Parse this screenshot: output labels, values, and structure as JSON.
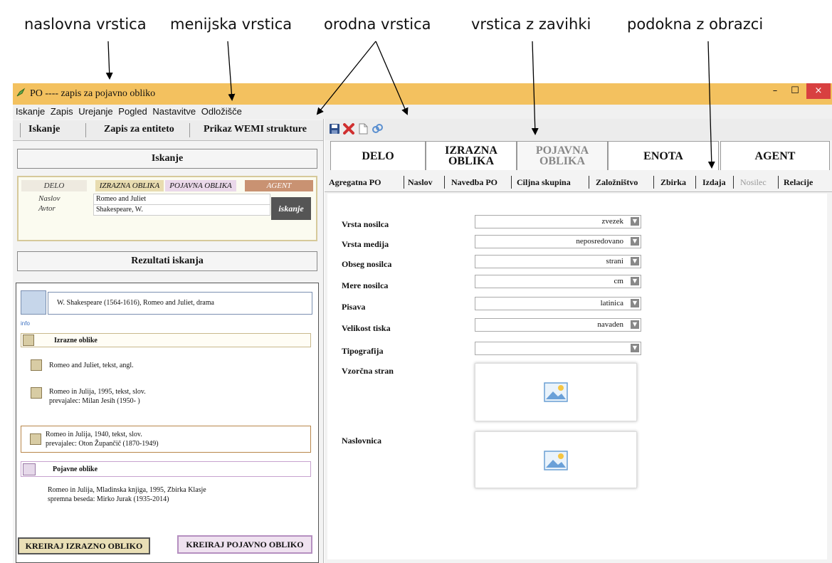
{
  "annotations": {
    "title_bar": "naslovna vrstica",
    "menu_bar": "menijska vrstica",
    "tool_bar": "orodna vrstica",
    "tab_bar": "vrstica z zavihki",
    "form_panes": "podokna z obrazci"
  },
  "window": {
    "title": "PO ---- zapis za pojavno obliko",
    "controls": {
      "minimize": "–",
      "maximize": "☐",
      "close": "×"
    }
  },
  "menu": {
    "items": [
      "Iskanje",
      "Zapis",
      "Urejanje",
      "Pogled",
      "Nastavitve",
      "Odložišče"
    ]
  },
  "left": {
    "tabs": [
      "Iskanje",
      "Zapis za entiteto",
      "Prikaz WEMI strukture"
    ],
    "search": {
      "heading": "Iskanje",
      "entity_tabs": [
        "DELO",
        "IZRAZNA OBLIKA",
        "POJAVNA OBLIKA",
        "AGENT"
      ],
      "fields": [
        {
          "label": "Naslov",
          "value": "Romeo and Juliet"
        },
        {
          "label": "Avtor",
          "value": "Shakespeare, W."
        }
      ],
      "button": "iskanje"
    },
    "results": {
      "heading": "Rezultati iskanja",
      "work": "W. Shakespeare (1564-1616), Romeo and Juliet, drama",
      "info": "info",
      "expressions_heading": "Izrazne oblike",
      "expressions": [
        {
          "line1": "Romeo and Juliet, tekst, angl.",
          "line2": ""
        },
        {
          "line1": "Romeo in Julija, 1995, tekst, slov.",
          "line2": "prevajalec: Milan Jesih (1950- )"
        },
        {
          "line1": "Romeo in Julija, 1940, tekst, slov.",
          "line2": "prevajalec: Oton Župančič (1870-1949)"
        }
      ],
      "manifestations_heading": "Pojavne oblike",
      "manifestation": {
        "line1": "Romeo in Julija, Mladinska knjiga, 1995, Zbirka Klasje",
        "line2": "spremna beseda: Mirko Jurak (1935-2014)"
      }
    },
    "buttons": {
      "create_expression": "KREIRAJ IZRAZNO OBLIKO",
      "create_manifestation": "KREIRAJ POJAVNO OBLIKO"
    }
  },
  "right": {
    "toolbar_icons": [
      "save-icon",
      "delete-icon",
      "new-document-icon",
      "link-icon"
    ],
    "main_tabs": [
      {
        "line1": "DELO",
        "line2": ""
      },
      {
        "line1": "IZRAZNA",
        "line2": "OBLIKA"
      },
      {
        "line1": "POJAVNA",
        "line2": "OBLIKA"
      },
      {
        "line1": "ENOTA",
        "line2": ""
      },
      {
        "line1": "AGENT",
        "line2": ""
      }
    ],
    "sub_tabs": [
      "Agregatna PO",
      "Naslov",
      "Navedba PO",
      "Ciljna skupina",
      "Založništvo",
      "Zbirka",
      "Izdaja",
      "Nosilec",
      "Relacije"
    ],
    "form": {
      "fields": [
        {
          "label": "Vrsta nosilca",
          "value": "zvezek"
        },
        {
          "label": "Vrsta medija",
          "value": "neposredovano"
        },
        {
          "label": "Obseg nosilca",
          "value": "strani"
        },
        {
          "label": "Mere nosilca",
          "value": "cm"
        },
        {
          "label": "Pisava",
          "value": "latinica"
        },
        {
          "label": "Velikost tiska",
          "value": "navaden"
        },
        {
          "label": "Tipografija",
          "value": ""
        }
      ],
      "sample_page_label": "Vzorčna stran",
      "cover_label": "Naslovnica"
    }
  }
}
